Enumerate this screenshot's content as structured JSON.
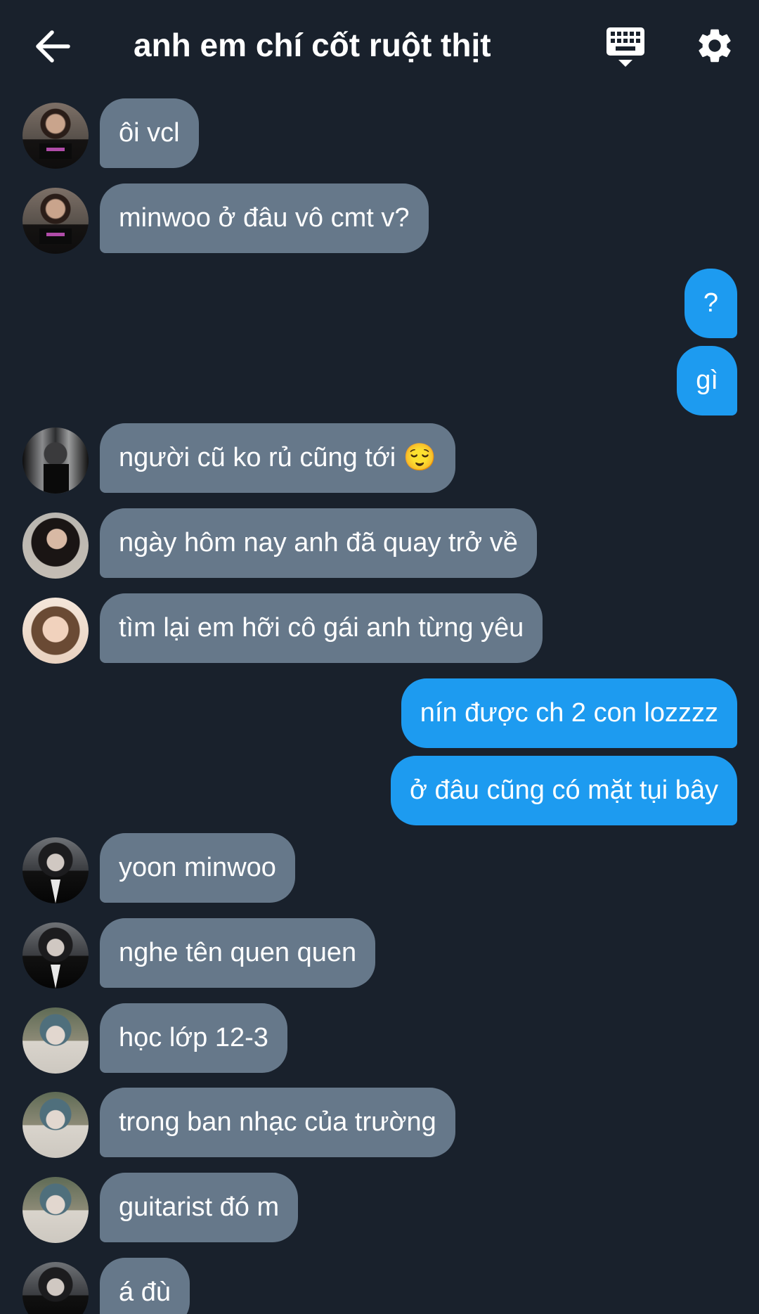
{
  "header": {
    "title": "anh em chí cốt ruột thịt",
    "back_icon": "arrow-left-icon",
    "keyboard_icon": "keyboard-hide-icon",
    "settings_icon": "gear-icon"
  },
  "colors": {
    "background": "#19212c",
    "incoming_bubble": "#66788a",
    "outgoing_bubble": "#1d9bf0",
    "text": "#ffffff"
  },
  "messages": [
    {
      "side": "in",
      "text": "ôi vcl"
    },
    {
      "side": "in",
      "text": "minwoo ở đâu vô cmt v?"
    },
    {
      "side": "out",
      "text": "?"
    },
    {
      "side": "out",
      "text": "gì"
    },
    {
      "side": "in",
      "text": "người cũ ko rủ cũng tới 😌"
    },
    {
      "side": "in",
      "text": "ngày hôm nay anh đã quay trở về"
    },
    {
      "side": "in",
      "text": "tìm lại em hỡi cô gái anh từng yêu"
    },
    {
      "side": "out",
      "text": "nín được ch 2 con lozzzz"
    },
    {
      "side": "out",
      "text": "ở đâu cũng có mặt tụi bây"
    },
    {
      "side": "in",
      "text": "yoon minwoo"
    },
    {
      "side": "in",
      "text": "nghe tên quen quen"
    },
    {
      "side": "in",
      "text": "học lớp 12-3"
    },
    {
      "side": "in",
      "text": "trong ban nhạc của trường"
    },
    {
      "side": "in",
      "text": "guitarist đó m"
    },
    {
      "side": "in",
      "text": "á đù"
    }
  ]
}
